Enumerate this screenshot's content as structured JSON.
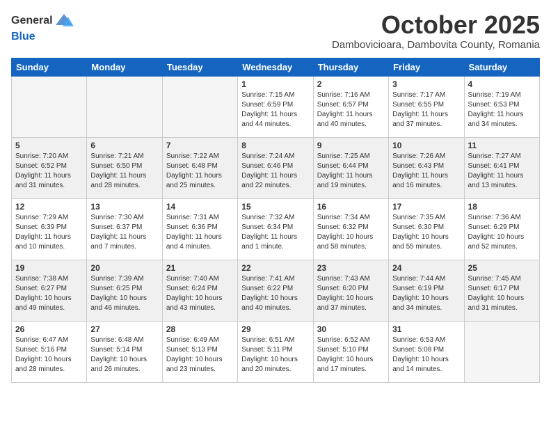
{
  "header": {
    "logo_general": "General",
    "logo_blue": "Blue",
    "month": "October 2025",
    "subtitle": "Dambovicioara, Dambovita County, Romania"
  },
  "weekdays": [
    "Sunday",
    "Monday",
    "Tuesday",
    "Wednesday",
    "Thursday",
    "Friday",
    "Saturday"
  ],
  "weeks": [
    [
      {
        "day": "",
        "info": ""
      },
      {
        "day": "",
        "info": ""
      },
      {
        "day": "",
        "info": ""
      },
      {
        "day": "1",
        "info": "Sunrise: 7:15 AM\nSunset: 6:59 PM\nDaylight: 11 hours and 44 minutes."
      },
      {
        "day": "2",
        "info": "Sunrise: 7:16 AM\nSunset: 6:57 PM\nDaylight: 11 hours and 40 minutes."
      },
      {
        "day": "3",
        "info": "Sunrise: 7:17 AM\nSunset: 6:55 PM\nDaylight: 11 hours and 37 minutes."
      },
      {
        "day": "4",
        "info": "Sunrise: 7:19 AM\nSunset: 6:53 PM\nDaylight: 11 hours and 34 minutes."
      }
    ],
    [
      {
        "day": "5",
        "info": "Sunrise: 7:20 AM\nSunset: 6:52 PM\nDaylight: 11 hours and 31 minutes."
      },
      {
        "day": "6",
        "info": "Sunrise: 7:21 AM\nSunset: 6:50 PM\nDaylight: 11 hours and 28 minutes."
      },
      {
        "day": "7",
        "info": "Sunrise: 7:22 AM\nSunset: 6:48 PM\nDaylight: 11 hours and 25 minutes."
      },
      {
        "day": "8",
        "info": "Sunrise: 7:24 AM\nSunset: 6:46 PM\nDaylight: 11 hours and 22 minutes."
      },
      {
        "day": "9",
        "info": "Sunrise: 7:25 AM\nSunset: 6:44 PM\nDaylight: 11 hours and 19 minutes."
      },
      {
        "day": "10",
        "info": "Sunrise: 7:26 AM\nSunset: 6:43 PM\nDaylight: 11 hours and 16 minutes."
      },
      {
        "day": "11",
        "info": "Sunrise: 7:27 AM\nSunset: 6:41 PM\nDaylight: 11 hours and 13 minutes."
      }
    ],
    [
      {
        "day": "12",
        "info": "Sunrise: 7:29 AM\nSunset: 6:39 PM\nDaylight: 11 hours and 10 minutes."
      },
      {
        "day": "13",
        "info": "Sunrise: 7:30 AM\nSunset: 6:37 PM\nDaylight: 11 hours and 7 minutes."
      },
      {
        "day": "14",
        "info": "Sunrise: 7:31 AM\nSunset: 6:36 PM\nDaylight: 11 hours and 4 minutes."
      },
      {
        "day": "15",
        "info": "Sunrise: 7:32 AM\nSunset: 6:34 PM\nDaylight: 11 hours and 1 minute."
      },
      {
        "day": "16",
        "info": "Sunrise: 7:34 AM\nSunset: 6:32 PM\nDaylight: 10 hours and 58 minutes."
      },
      {
        "day": "17",
        "info": "Sunrise: 7:35 AM\nSunset: 6:30 PM\nDaylight: 10 hours and 55 minutes."
      },
      {
        "day": "18",
        "info": "Sunrise: 7:36 AM\nSunset: 6:29 PM\nDaylight: 10 hours and 52 minutes."
      }
    ],
    [
      {
        "day": "19",
        "info": "Sunrise: 7:38 AM\nSunset: 6:27 PM\nDaylight: 10 hours and 49 minutes."
      },
      {
        "day": "20",
        "info": "Sunrise: 7:39 AM\nSunset: 6:25 PM\nDaylight: 10 hours and 46 minutes."
      },
      {
        "day": "21",
        "info": "Sunrise: 7:40 AM\nSunset: 6:24 PM\nDaylight: 10 hours and 43 minutes."
      },
      {
        "day": "22",
        "info": "Sunrise: 7:41 AM\nSunset: 6:22 PM\nDaylight: 10 hours and 40 minutes."
      },
      {
        "day": "23",
        "info": "Sunrise: 7:43 AM\nSunset: 6:20 PM\nDaylight: 10 hours and 37 minutes."
      },
      {
        "day": "24",
        "info": "Sunrise: 7:44 AM\nSunset: 6:19 PM\nDaylight: 10 hours and 34 minutes."
      },
      {
        "day": "25",
        "info": "Sunrise: 7:45 AM\nSunset: 6:17 PM\nDaylight: 10 hours and 31 minutes."
      }
    ],
    [
      {
        "day": "26",
        "info": "Sunrise: 6:47 AM\nSunset: 5:16 PM\nDaylight: 10 hours and 28 minutes."
      },
      {
        "day": "27",
        "info": "Sunrise: 6:48 AM\nSunset: 5:14 PM\nDaylight: 10 hours and 26 minutes."
      },
      {
        "day": "28",
        "info": "Sunrise: 6:49 AM\nSunset: 5:13 PM\nDaylight: 10 hours and 23 minutes."
      },
      {
        "day": "29",
        "info": "Sunrise: 6:51 AM\nSunset: 5:11 PM\nDaylight: 10 hours and 20 minutes."
      },
      {
        "day": "30",
        "info": "Sunrise: 6:52 AM\nSunset: 5:10 PM\nDaylight: 10 hours and 17 minutes."
      },
      {
        "day": "31",
        "info": "Sunrise: 6:53 AM\nSunset: 5:08 PM\nDaylight: 10 hours and 14 minutes."
      },
      {
        "day": "",
        "info": ""
      }
    ]
  ]
}
